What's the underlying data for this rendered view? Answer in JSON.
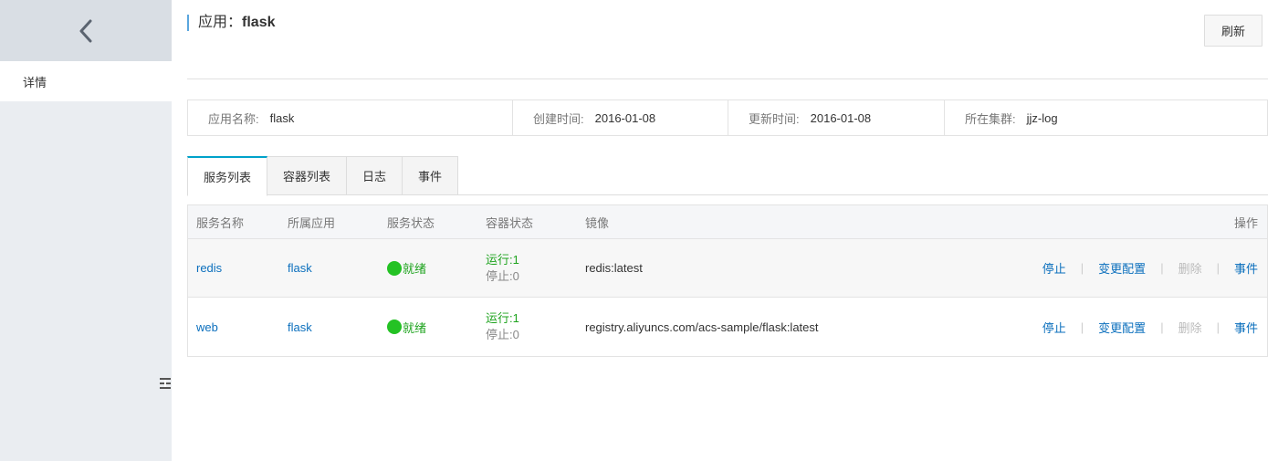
{
  "sidebar": {
    "back_icon": "chevron-left-icon",
    "active_item": "详情",
    "collapse_icon": "collapse-icon"
  },
  "header": {
    "title_label": "应用：",
    "title_value": "flask",
    "refresh_label": "刷新"
  },
  "info": [
    {
      "label": "应用名称:",
      "value": "flask"
    },
    {
      "label": "创建时间:",
      "value": "2016-01-08"
    },
    {
      "label": "更新时间:",
      "value": "2016-01-08"
    },
    {
      "label": "所在集群:",
      "value": "jjz-log"
    }
  ],
  "tabs": [
    "服务列表",
    "容器列表",
    "日志",
    "事件"
  ],
  "active_tab": "服务列表",
  "table": {
    "columns": [
      "服务名称",
      "所属应用",
      "服务状态",
      "容器状态",
      "镜像",
      "操作"
    ],
    "rows": [
      {
        "name": "redis",
        "app": "flask",
        "status": "就绪",
        "running": "运行:1",
        "stopped": "停止:0",
        "image": "redis:latest"
      },
      {
        "name": "web",
        "app": "flask",
        "status": "就绪",
        "running": "运行:1",
        "stopped": "停止:0",
        "image": "registry.aliyuncs.com/acs-sample/flask:latest"
      }
    ],
    "actions": {
      "stop": "停止",
      "config": "变更配置",
      "delete": "删除",
      "events": "事件",
      "separator": "|"
    }
  },
  "colors": {
    "accent": "#00a2ca",
    "link": "#0b6fbd",
    "ready": "#24c224"
  }
}
